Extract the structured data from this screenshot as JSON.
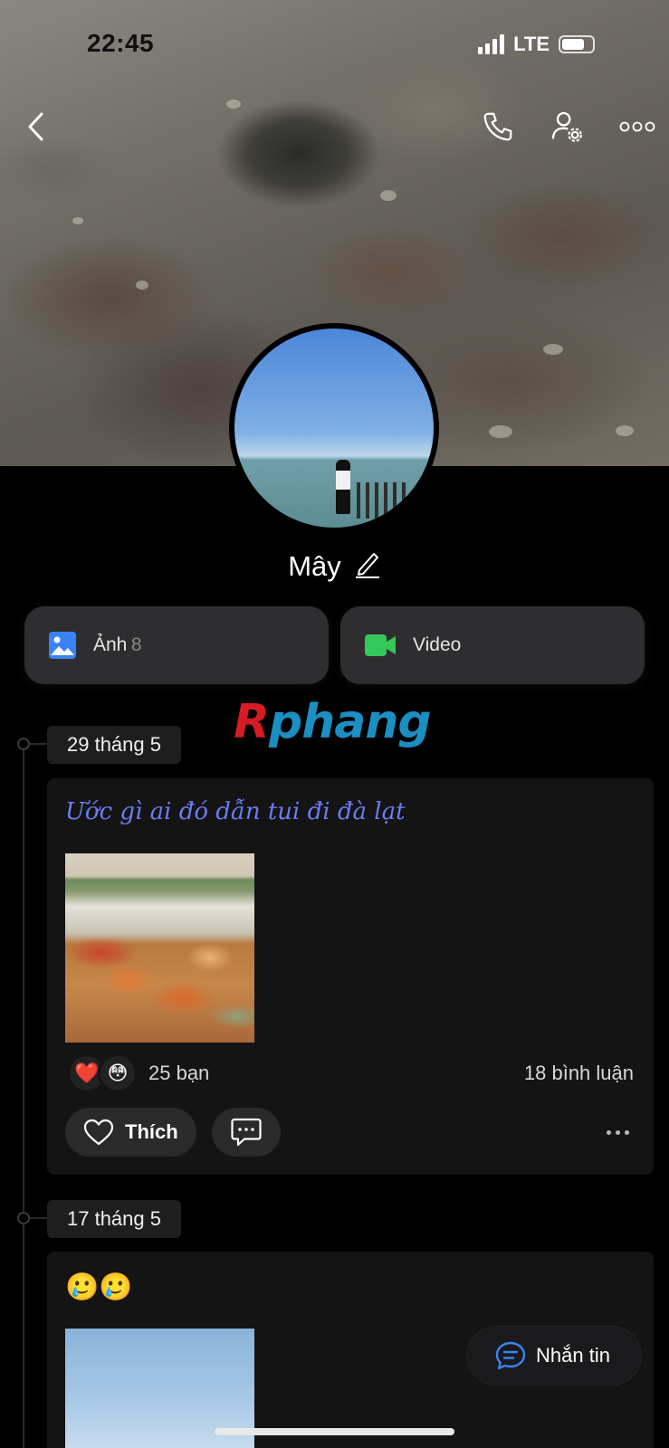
{
  "status_bar": {
    "time": "22:45",
    "network": "LTE"
  },
  "profile": {
    "name": "Mây"
  },
  "media": {
    "photos_label": "Ảnh",
    "photos_count": "8",
    "video_label": "Video"
  },
  "watermark": "Rphang",
  "posts": [
    {
      "date": "29 tháng 5",
      "text": "Ước gì ai đó dẫn tui đi đà lạt",
      "reactions": [
        "❤️",
        "😳"
      ],
      "reaction_count": "25 bạn",
      "comment_count": "18 bình luận",
      "like_label": "Thích"
    },
    {
      "date": "17 tháng 5",
      "text": "🥲🥲"
    }
  ],
  "message_button": {
    "label": "Nhắn tin"
  },
  "icons": {
    "back": "chevron-left-icon",
    "call": "phone-icon",
    "settings": "user-settings-icon",
    "more": "more-horizontal-icon",
    "edit": "pencil-icon",
    "photos": "image-icon",
    "video": "video-camera-icon",
    "like": "heart-outline-icon",
    "comment": "chat-bubble-icon",
    "message": "message-icon"
  },
  "colors": {
    "accent_blue": "#3b82f6",
    "video_green": "#34c759",
    "caption_purple": "#6b7cf0",
    "card_bg": "#141414"
  }
}
